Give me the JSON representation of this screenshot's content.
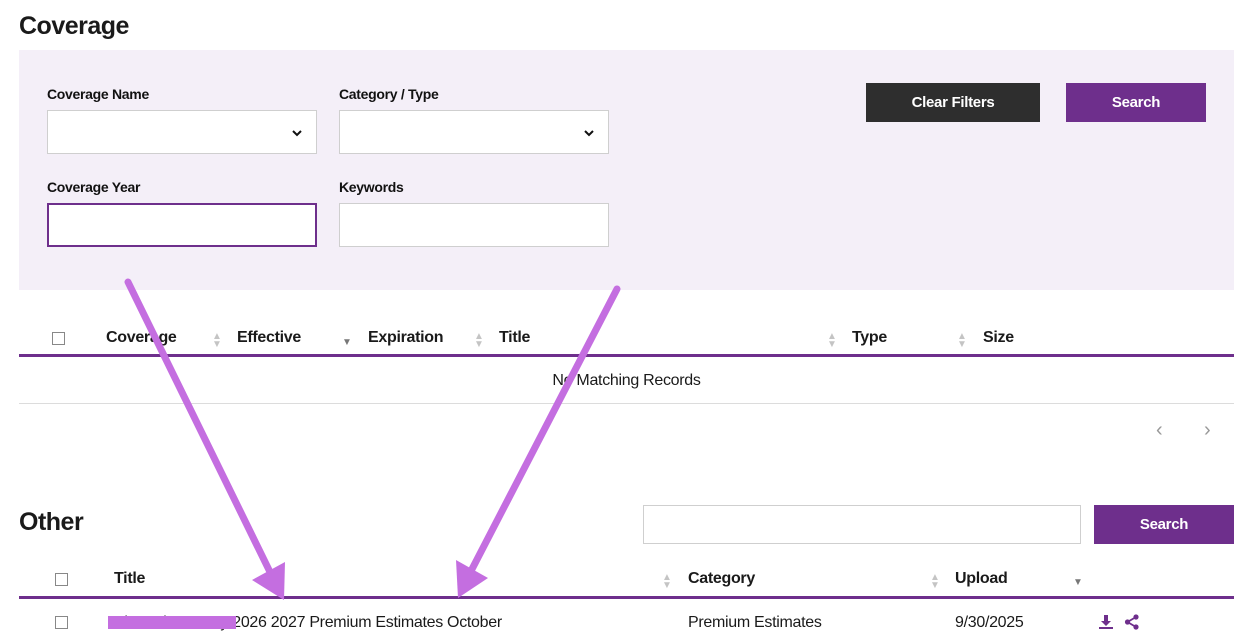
{
  "coverage": {
    "title": "Coverage",
    "filters": {
      "coverage_name_label": "Coverage Name",
      "coverage_name_value": "",
      "category_type_label": "Category / Type",
      "category_type_value": "",
      "coverage_year_label": "Coverage Year",
      "coverage_year_value": "",
      "keywords_label": "Keywords",
      "keywords_value": ""
    },
    "clear_filters_label": "Clear Filters",
    "search_label": "Search",
    "table": {
      "headers": [
        "Coverage",
        "Effective",
        "Expiration",
        "Title",
        "Type",
        "Size"
      ],
      "empty_message": "No Matching Records"
    },
    "pager": {
      "prev": "‹",
      "next": "›"
    }
  },
  "other": {
    "title": "Other",
    "search_value": "",
    "search_label": "Search",
    "table": {
      "headers": [
        "Title",
        "Category",
        "Upload"
      ],
      "rows": [
        {
          "title": "Alameda County 2026 2027 Premium Estimates October",
          "category": "Premium Estimates",
          "upload": "9/30/2025"
        }
      ]
    }
  },
  "icons": {
    "download": "download-icon",
    "share": "share-icon"
  },
  "colors": {
    "accent": "#6e2f8c",
    "panel": "#f4eff8",
    "dark_button": "#2e2e2e",
    "annotation": "#c46ee0"
  }
}
